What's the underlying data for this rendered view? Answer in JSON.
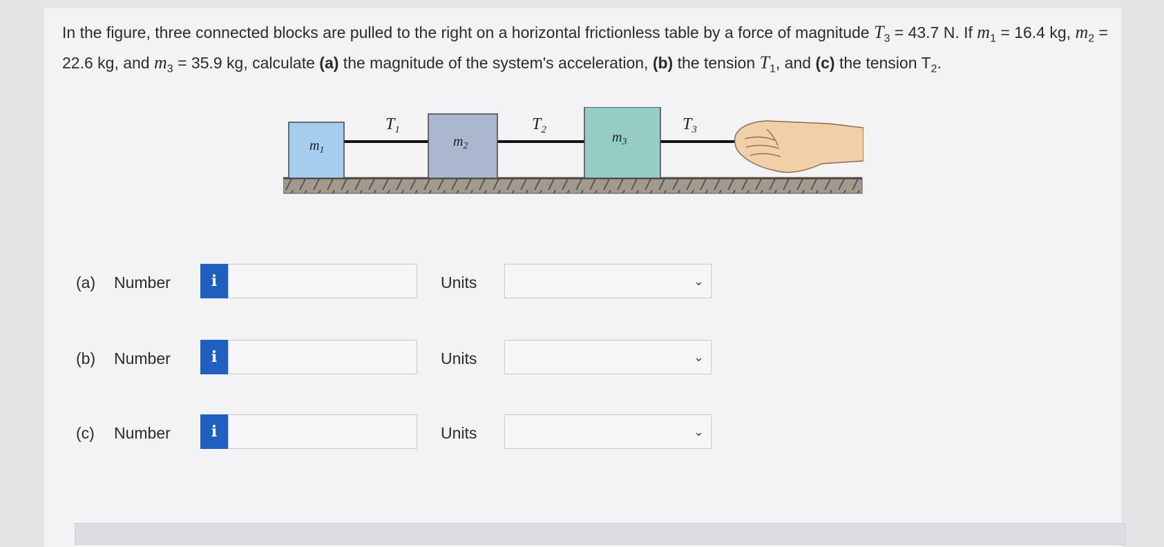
{
  "question": {
    "p1": "In the figure, three connected blocks are pulled to the right on a horizontal frictionless table by a force of magnitude ",
    "T3_sym": "T",
    "T3_sub": "3",
    "p2": " = 43.7 N. If ",
    "m1_sym": "m",
    "m1_sub": "1",
    "p3": " = 16.4 kg, ",
    "m2_sym": "m",
    "m2_sub": "2",
    "p4": " = 22.6 kg, and ",
    "m3_sym": "m",
    "m3_sub": "3",
    "p5": " = 35.9 kg, calculate ",
    "a_label": "(a)",
    "p6": " the magnitude of the system's acceleration, ",
    "b_label": "(b)",
    "p7": " the tension ",
    "T1_sym": "T",
    "T1_sub": "1",
    "p8": ", and ",
    "c_label": "(c)",
    "p9": " the tension ",
    "T2_sym": "T",
    "T2_sub": "2",
    "p10": "."
  },
  "figure": {
    "blocks": [
      {
        "label": "m",
        "sub": "1",
        "color": "#a7cdee"
      },
      {
        "label": "m",
        "sub": "2",
        "color": "#aab7cc"
      },
      {
        "label": "m",
        "sub": "3",
        "color": "#95cdc6"
      }
    ],
    "tensions": [
      {
        "label": "T",
        "sub": "1"
      },
      {
        "label": "T",
        "sub": "2"
      },
      {
        "label": "T",
        "sub": "3"
      }
    ],
    "hand_color": "#f1cfa8"
  },
  "answers": [
    {
      "part": "(a)",
      "number_label": "Number",
      "info": "i",
      "number_value": "",
      "units_label": "Units",
      "units_value": ""
    },
    {
      "part": "(b)",
      "number_label": "Number",
      "info": "i",
      "number_value": "",
      "units_label": "Units",
      "units_value": ""
    },
    {
      "part": "(c)",
      "number_label": "Number",
      "info": "i",
      "number_value": "",
      "units_label": "Units",
      "units_value": ""
    }
  ],
  "colors": {
    "info_button": "#1f5fbf",
    "page_bg": "#f3f3f5"
  }
}
